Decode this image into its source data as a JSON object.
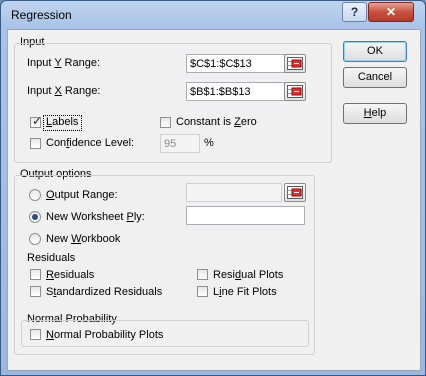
{
  "window": {
    "title": "Regression"
  },
  "titlebar": {
    "help_label": "?",
    "close_label": "✕"
  },
  "input": {
    "group_label": "Input",
    "y_range": {
      "label_pre": "Input ",
      "label_u": "Y",
      "label_post": " Range:",
      "value": "$C$1:$C$13"
    },
    "x_range": {
      "label_pre": "Input ",
      "label_u": "X",
      "label_post": " Range:",
      "value": "$B$1:$B$13"
    },
    "labels": {
      "label_u": "L",
      "label_post": "abels",
      "checked": true
    },
    "constant_zero": {
      "label_pre": "Constant is ",
      "label_u": "Z",
      "label_post": "ero",
      "checked": false
    },
    "confidence": {
      "label_pre": "Con",
      "label_u": "f",
      "label_post": "idence Level:",
      "checked": false,
      "value": "95",
      "unit": "%"
    }
  },
  "output": {
    "group_label": "Output options",
    "output_range": {
      "label_u": "O",
      "label_post": "utput Range:",
      "selected": false,
      "value": ""
    },
    "new_ply": {
      "label_pre": "New Worksheet ",
      "label_u": "P",
      "label_post": "ly:",
      "selected": true,
      "value": ""
    },
    "new_workbook": {
      "label_pre": "New ",
      "label_u": "W",
      "label_post": "orkbook",
      "selected": false
    }
  },
  "residuals": {
    "group_label": "Residuals",
    "residuals": {
      "label_u": "R",
      "label_post": "esiduals",
      "checked": false
    },
    "standardized": {
      "label_pre": "S",
      "label_u": "t",
      "label_post": "andardized Residuals",
      "checked": false
    },
    "residual_plots": {
      "label_pre": "Resi",
      "label_u": "d",
      "label_post": "ual Plots",
      "checked": false
    },
    "line_fit": {
      "label_pre": "L",
      "label_u": "i",
      "label_post": "ne Fit Plots",
      "checked": false
    }
  },
  "normal": {
    "group_label": "Normal Probability",
    "plots": {
      "label_u": "N",
      "label_post": "ormal Probability Plots",
      "checked": false
    }
  },
  "buttons": {
    "ok": "OK",
    "cancel": "Cancel",
    "help_pre": "",
    "help_u": "H",
    "help_post": "elp"
  },
  "icons": {
    "range_selector": "range-select-icon"
  }
}
